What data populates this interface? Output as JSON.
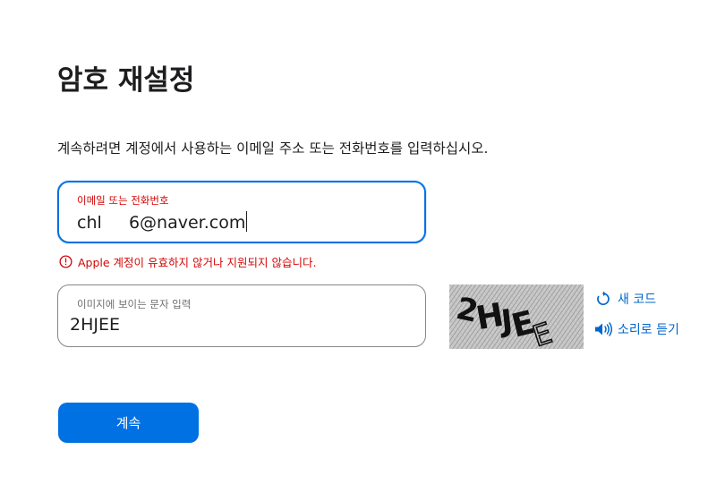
{
  "page": {
    "title": "암호 재설정",
    "instructions": "계속하려면 계정에서 사용하는 이메일 주소 또는 전화번호를 입력하십시오."
  },
  "email_field": {
    "label": "이메일 또는 전화번호",
    "value": "chl     6@naver.com"
  },
  "error": {
    "icon": "error-circle-icon",
    "message": "Apple 계정이 유효하지 않거나 지원되지 않습니다."
  },
  "captcha_field": {
    "label": "이미지에 보이는 문자 입력",
    "value": "2HJEE"
  },
  "captcha_image": {
    "text": "2HJEE"
  },
  "captcha_actions": {
    "new_code": {
      "label": "새 코드",
      "icon": "refresh-icon"
    },
    "listen": {
      "label": "소리로 듣기",
      "icon": "speaker-icon"
    }
  },
  "continue_button": {
    "label": "계속"
  },
  "colors": {
    "accent": "#0071e3",
    "link": "#0066cc",
    "error": "#d30505",
    "text": "#1d1d1f"
  }
}
